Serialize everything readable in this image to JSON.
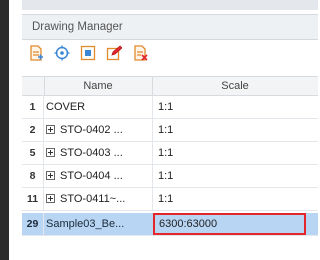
{
  "panel": {
    "title": "Drawing Manager"
  },
  "toolbar": {
    "icons": [
      "add-drawing-icon",
      "target-icon",
      "fit-icon",
      "edit-icon",
      "remove-drawing-icon"
    ]
  },
  "table": {
    "columns": {
      "name": "Name",
      "scale": "Scale"
    },
    "rows": [
      {
        "num": "1",
        "name": "COVER",
        "scale": "1:1",
        "expandable": false
      },
      {
        "num": "2",
        "name": "STO-0402 ...",
        "scale": "1:1",
        "expandable": true
      },
      {
        "num": "5",
        "name": "STO-0403 ...",
        "scale": "1:1",
        "expandable": true
      },
      {
        "num": "8",
        "name": "STO-0404 ...",
        "scale": "1:1",
        "expandable": true
      },
      {
        "num": "11",
        "name": "STO-0411~...",
        "scale": "1:1",
        "expandable": true
      },
      {
        "num": "29",
        "name": "Sample03_Be...",
        "scale": "6300:63000",
        "expandable": false,
        "selected": true
      }
    ]
  },
  "colors": {
    "selection": "#b8d5f3",
    "highlight_box": "#e2262a",
    "toolbar_orange": "#e08a2c",
    "toolbar_blue": "#3a86d6"
  }
}
